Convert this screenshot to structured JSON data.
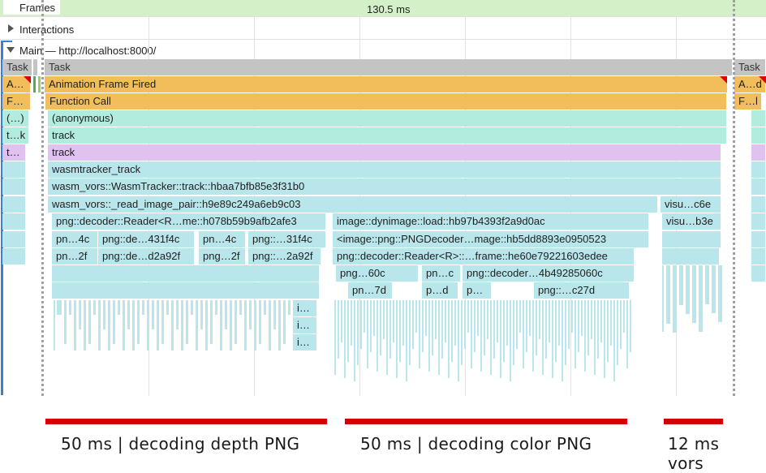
{
  "tracks": {
    "frames_label": "Frames",
    "frame_duration": "130.5 ms",
    "interactions_label": "Interactions",
    "interactions_icon": "chevron-right-icon",
    "main_label": "Main — http://localhost:8000/",
    "main_icon": "chevron-down-icon"
  },
  "flame": {
    "task_left": "Task",
    "task_main": "Task",
    "task_right": "Task",
    "anim_left": "A…",
    "anim_main": "Animation Frame Fired",
    "anim_right": "A…d",
    "func_left": "F…",
    "func_main": "Function Call",
    "func_right": "F…l",
    "anon_left": "(…)",
    "anon_main": "(anonymous)",
    "track_left": "t…k",
    "track_main": "track",
    "track2_left": "t…",
    "track2_main": "track",
    "wasm_track": "wasmtracker_track",
    "wasm_tracker": "wasm_vors::WasmTracker::track::hbaa7bfb85e3f31b0",
    "read_pair": "wasm_vors::_read_image_pair::h9e89c249a6eb9c03",
    "visu_1": "visu…c6e",
    "reader": "png::decoder::Reader<R…me::h078b59b9afb2afe3",
    "dynimage": "image::dynimage::load::hb97b4393f2a9d0ac",
    "visu_2": "visu…b3e",
    "r9_1": "pn…4c",
    "r9_2": "png::de…431f4c",
    "r9_3": "pn…4c",
    "r9_4": "png::…31f4c",
    "png_decoder": "<image::png::PNGDecoder…mage::hb5dd8893e0950523",
    "r10_1": "pn…2f",
    "r10_2": "png::de…d2a92f",
    "r10_3": "png…2f",
    "r10_4": "png::…2a92f",
    "reader_frame": "png::decoder::Reader<R>::…frame::he60e79221603edee",
    "r11_1": "png…60c",
    "r11_2": "pn…c",
    "r11_3": "png::decoder…4b49285060c",
    "r12_1": "pn…7d",
    "r12_2": "p…d",
    "r12_3": "p…",
    "r12_4": "png::…c27d",
    "i1": "i…",
    "i2": "i…",
    "i3": "i…"
  },
  "annotations": {
    "depth": "50 ms | decoding depth PNG",
    "color": "50 ms | decoding color PNG",
    "vors_line1": "12 ms",
    "vors_line2": "vors"
  },
  "colors": {
    "frames_bg": "#d4f0c9",
    "task": "#c4c4c4",
    "animation": "#f2be5b",
    "function_call": "#f2be5b",
    "anonymous": "#b2ecdf",
    "track_purple": "#e0c2f1",
    "wasm": "#b8e6eb",
    "annotation_bar": "#d40000",
    "main_accent": "#3c7ed6"
  }
}
